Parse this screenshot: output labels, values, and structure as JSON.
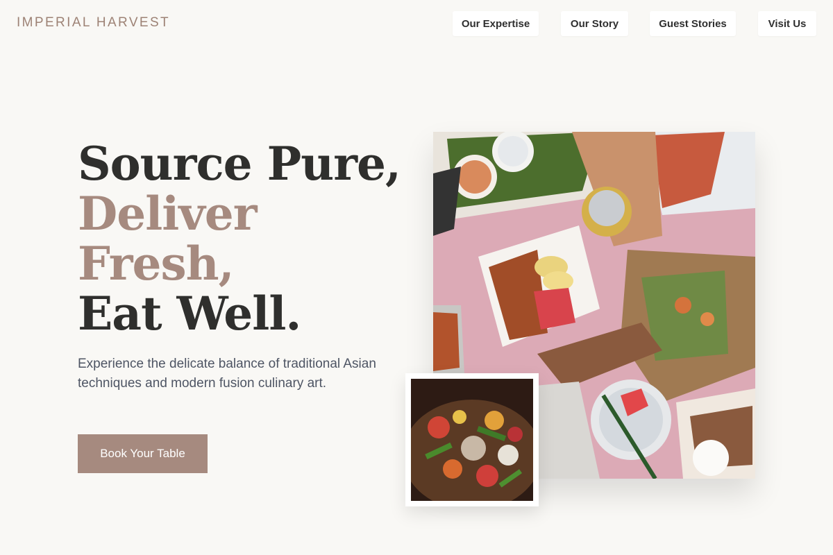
{
  "brand": {
    "name": "IMPERIAL HARVEST"
  },
  "nav": {
    "items": [
      {
        "label": "Our Expertise"
      },
      {
        "label": "Our Story"
      },
      {
        "label": "Guest Stories"
      },
      {
        "label": "Visit Us"
      }
    ]
  },
  "hero": {
    "headline": {
      "line1": "Source Pure,",
      "line2": "Deliver",
      "line3": "Fresh,",
      "line4": "Eat Well."
    },
    "subtitle": "Experience the delicate balance of traditional Asian techniques and modern fusion culinary art.",
    "cta_label": "Book Your Table"
  },
  "images": {
    "main": "overhead-food-spread-photo",
    "inset": "stir-fry-close-up-photo"
  },
  "colors": {
    "accent": "#a68a7f",
    "text_dark": "#2f2f2d",
    "background": "#f9f8f5",
    "subtitle": "#4e5564"
  }
}
